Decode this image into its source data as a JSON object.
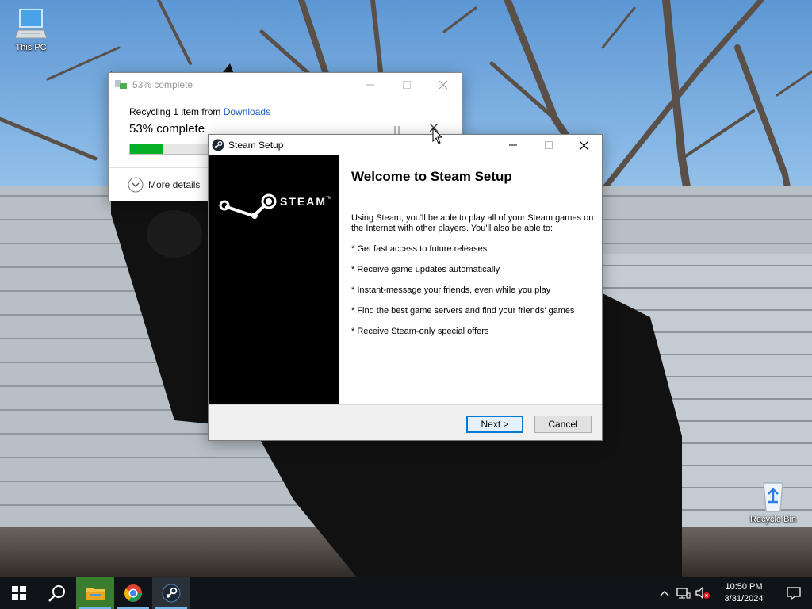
{
  "desktop": {
    "icons": [
      {
        "label": "This PC",
        "icon": "computer-icon"
      },
      {
        "label": "Recycle Bin",
        "icon": "recycle-bin-icon"
      }
    ]
  },
  "progress_dialog": {
    "title": "53% complete",
    "message_prefix": "Recycling 1 item from ",
    "message_link": "Downloads",
    "percent_text": "53% complete",
    "progress": 0.16,
    "more_details": "More details",
    "accent_color": "#06b025"
  },
  "steam_setup": {
    "title": "Steam Setup",
    "logo_text": "STEAM",
    "logo_tm": "TM",
    "heading": "Welcome to Steam Setup",
    "intro": "Using Steam, you'll be able to play all of your Steam games on the Internet with other players. You'll also be able to:",
    "features": [
      "* Get fast access to future releases",
      "* Receive game updates automatically",
      "* Instant-message your friends, even while you play",
      "* Find the best game servers and find your friends' games",
      "* Receive Steam-only special offers"
    ],
    "buttons": {
      "next": "Next >",
      "cancel": "Cancel"
    }
  },
  "taskbar": {
    "apps": [
      "start-icon",
      "search-icon",
      "file-explorer-icon",
      "chrome-icon",
      "steam-icon"
    ],
    "tray": {
      "time": "10:50 PM",
      "date": "3/31/2024"
    }
  }
}
